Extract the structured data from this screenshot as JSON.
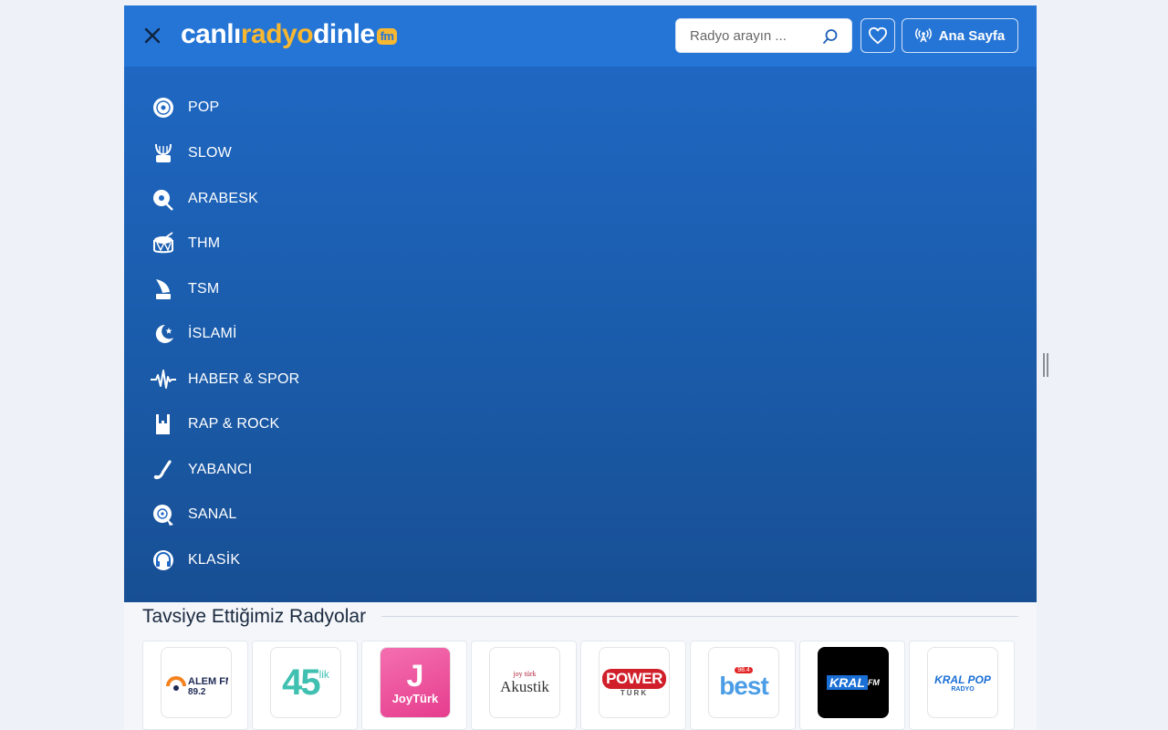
{
  "header": {
    "logo": {
      "part1": "canlı",
      "part2": "radyo",
      "part3": "dinle",
      "badge": "fm"
    },
    "search_placeholder": "Radyo arayın ...",
    "home_label": "Ana Sayfa"
  },
  "menu": {
    "items": [
      {
        "label": "POP",
        "icon": "vinyl-icon"
      },
      {
        "label": "SLOW",
        "icon": "lyre-icon"
      },
      {
        "label": "ARABESK",
        "icon": "saz-icon"
      },
      {
        "label": "THM",
        "icon": "drum-icon"
      },
      {
        "label": "TSM",
        "icon": "gramophone-icon"
      },
      {
        "label": "İSLAMİ",
        "icon": "crescent-icon"
      },
      {
        "label": "HABER & SPOR",
        "icon": "pulse-icon"
      },
      {
        "label": "RAP & ROCK",
        "icon": "rock-hand-icon"
      },
      {
        "label": "YABANCI",
        "icon": "saxophone-icon"
      },
      {
        "label": "SANAL",
        "icon": "dj-icon"
      },
      {
        "label": "KLASİK",
        "icon": "headphones-icon"
      }
    ]
  },
  "recommended": {
    "title": "Tavsiye Ettiğimiz Radyolar",
    "stations": [
      {
        "name": "ALEM FM",
        "sub": "89.2"
      },
      {
        "name": "45",
        "sub": "lik"
      },
      {
        "name": "JoyTürk",
        "sub": ""
      },
      {
        "name": "Akustik",
        "sub": "joy türk"
      },
      {
        "name": "POWER",
        "sub": "TÜRK"
      },
      {
        "name": "best",
        "sub": "98.4"
      },
      {
        "name": "KRAL",
        "sub": "FM"
      },
      {
        "name": "KRAL POP",
        "sub": "RADYO"
      }
    ]
  },
  "colors": {
    "topbar": "#2575d6",
    "menu": "#1a5ba9",
    "accent": "#f7b731"
  }
}
